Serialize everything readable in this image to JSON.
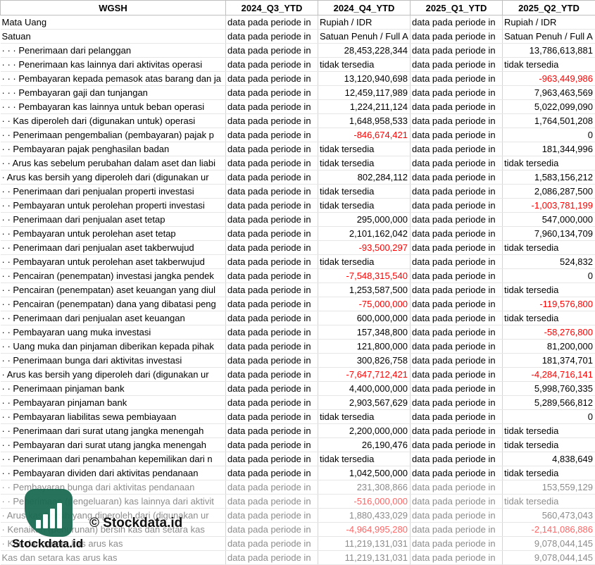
{
  "header": [
    "WGSH",
    "2024_Q3_YTD",
    "2024_Q4_YTD",
    "2025_Q1_YTD",
    "2025_Q2_YTD"
  ],
  "rows": [
    {
      "label": "Mata Uang",
      "cells": [
        "data pada periode in",
        "Rupiah / IDR",
        "data pada periode in",
        "Rupiah / IDR"
      ]
    },
    {
      "label": "Satuan",
      "cells": [
        "data pada periode in",
        "Satuan Penuh / Full A",
        "data pada periode in",
        "Satuan Penuh / Full A"
      ]
    },
    {
      "label": "· · · Penerimaan dari pelanggan",
      "cells": [
        "data pada periode in",
        "28,453,228,344",
        "data pada periode in",
        "13,786,613,881"
      ]
    },
    {
      "label": "· · · Penerimaan kas lainnya dari aktivitas operasi",
      "cells": [
        "data pada periode in",
        "tidak tersedia",
        "data pada periode in",
        "tidak tersedia"
      ]
    },
    {
      "label": "· · · Pembayaran kepada pemasok atas barang dan ja",
      "cells": [
        "data pada periode in",
        "13,120,940,698",
        "data pada periode in",
        "-963,449,986"
      ]
    },
    {
      "label": "· · · Pembayaran gaji dan tunjangan",
      "cells": [
        "data pada periode in",
        "12,459,117,989",
        "data pada periode in",
        "7,963,463,569"
      ]
    },
    {
      "label": "· · · Pembayaran kas lainnya untuk beban operasi",
      "cells": [
        "data pada periode in",
        "1,224,211,124",
        "data pada periode in",
        "5,022,099,090"
      ]
    },
    {
      "label": "· · Kas diperoleh dari (digunakan untuk) operasi",
      "cells": [
        "data pada periode in",
        "1,648,958,533",
        "data pada periode in",
        "1,764,501,208"
      ]
    },
    {
      "label": "· · Penerimaan pengembalian (pembayaran) pajak p",
      "cells": [
        "data pada periode in",
        "-846,674,421",
        "data pada periode in",
        "0"
      ]
    },
    {
      "label": "· · Pembayaran pajak penghasilan badan",
      "cells": [
        "data pada periode in",
        "tidak tersedia",
        "data pada periode in",
        "181,344,996"
      ]
    },
    {
      "label": "· · Arus kas sebelum perubahan dalam aset dan liabi",
      "cells": [
        "data pada periode in",
        "tidak tersedia",
        "data pada periode in",
        "tidak tersedia"
      ]
    },
    {
      "label": "· Arus kas bersih yang diperoleh dari (digunakan ur",
      "cells": [
        "data pada periode in",
        "802,284,112",
        "data pada periode in",
        "1,583,156,212"
      ]
    },
    {
      "label": "· · Penerimaan dari penjualan properti investasi",
      "cells": [
        "data pada periode in",
        "tidak tersedia",
        "data pada periode in",
        "2,086,287,500"
      ]
    },
    {
      "label": "· · Pembayaran untuk perolehan properti investasi",
      "cells": [
        "data pada periode in",
        "tidak tersedia",
        "data pada periode in",
        "-1,003,781,199"
      ]
    },
    {
      "label": "· · Penerimaan dari penjualan aset tetap",
      "cells": [
        "data pada periode in",
        "295,000,000",
        "data pada periode in",
        "547,000,000"
      ]
    },
    {
      "label": "· · Pembayaran untuk perolehan aset tetap",
      "cells": [
        "data pada periode in",
        "2,101,162,042",
        "data pada periode in",
        "7,960,134,709"
      ]
    },
    {
      "label": "· · Penerimaan dari penjualan aset takberwujud",
      "cells": [
        "data pada periode in",
        "-93,500,297",
        "data pada periode in",
        "tidak tersedia"
      ]
    },
    {
      "label": "· · Pembayaran untuk perolehan aset takberwujud",
      "cells": [
        "data pada periode in",
        "tidak tersedia",
        "data pada periode in",
        "524,832"
      ]
    },
    {
      "label": "· · Pencairan (penempatan) investasi jangka pendek",
      "cells": [
        "data pada periode in",
        "-7,548,315,540",
        "data pada periode in",
        "0"
      ]
    },
    {
      "label": "· · Pencairan (penempatan) aset keuangan yang diul",
      "cells": [
        "data pada periode in",
        "1,253,587,500",
        "data pada periode in",
        "tidak tersedia"
      ]
    },
    {
      "label": "· · Pencairan (penempatan) dana yang dibatasi peng",
      "cells": [
        "data pada periode in",
        "-75,000,000",
        "data pada periode in",
        "-119,576,800"
      ]
    },
    {
      "label": "· · Penerimaan dari penjualan aset keuangan",
      "cells": [
        "data pada periode in",
        "600,000,000",
        "data pada periode in",
        "tidak tersedia"
      ]
    },
    {
      "label": "· · Pembayaran uang muka investasi",
      "cells": [
        "data pada periode in",
        "157,348,800",
        "data pada periode in",
        "-58,276,800"
      ]
    },
    {
      "label": "· · Uang muka dan pinjaman diberikan kepada pihak",
      "cells": [
        "data pada periode in",
        "121,800,000",
        "data pada periode in",
        "81,200,000"
      ]
    },
    {
      "label": "· · Penerimaan bunga dari aktivitas investasi",
      "cells": [
        "data pada periode in",
        "300,826,758",
        "data pada periode in",
        "181,374,701"
      ]
    },
    {
      "label": "· Arus kas bersih yang diperoleh dari (digunakan ur",
      "cells": [
        "data pada periode in",
        "-7,647,712,421",
        "data pada periode in",
        "-4,284,716,141"
      ]
    },
    {
      "label": "· · Penerimaan pinjaman bank",
      "cells": [
        "data pada periode in",
        "4,400,000,000",
        "data pada periode in",
        "5,998,760,335"
      ]
    },
    {
      "label": "· · Pembayaran pinjaman bank",
      "cells": [
        "data pada periode in",
        "2,903,567,629",
        "data pada periode in",
        "5,289,566,812"
      ]
    },
    {
      "label": "· · Pembayaran liabilitas sewa pembiayaan",
      "cells": [
        "data pada periode in",
        "tidak tersedia",
        "data pada periode in",
        "0"
      ]
    },
    {
      "label": "· · Penerimaan dari surat utang jangka menengah",
      "cells": [
        "data pada periode in",
        "2,200,000,000",
        "data pada periode in",
        "tidak tersedia"
      ]
    },
    {
      "label": "· · Pembayaran dari surat utang jangka menengah",
      "cells": [
        "data pada periode in",
        "26,190,476",
        "data pada periode in",
        "tidak tersedia"
      ]
    },
    {
      "label": "· · Penerimaan dari penambahan kepemilikan dari n",
      "cells": [
        "data pada periode in",
        "tidak tersedia",
        "data pada periode in",
        "4,838,649"
      ]
    },
    {
      "label": "· · Pembayaran dividen dari aktivitas pendanaan",
      "cells": [
        "data pada periode in",
        "1,042,500,000",
        "data pada periode in",
        "tidak tersedia"
      ]
    },
    {
      "label": "· · Pembayaran bunga dari aktivitas pendanaan",
      "cells": [
        "data pada periode in",
        "231,308,866",
        "data pada periode in",
        "153,559,129"
      ],
      "faded": true
    },
    {
      "label": "· · Penerimaan (pengeluaran) kas lainnya dari aktivit",
      "cells": [
        "data pada periode in",
        "-516,000,000",
        "data pada periode in",
        "tidak tersedia"
      ],
      "faded": true
    },
    {
      "label": "· Arus kas bersih yang diperoleh dari (digunakan ur",
      "cells": [
        "data pada periode in",
        "1,880,433,029",
        "data pada periode in",
        "560,473,043"
      ],
      "faded": true
    },
    {
      "label": "· Kenaikan (penurunan) bersih kas dan setara kas",
      "cells": [
        "data pada periode in",
        "-4,964,995,280",
        "data pada periode in",
        "-2,141,086,886"
      ],
      "faded": true
    },
    {
      "label": "· Kas dan setara kas arus kas",
      "cells": [
        "data pada periode in",
        "11,219,131,031",
        "data pada periode in",
        "9,078,044,145"
      ],
      "faded": true
    },
    {
      "label": "Kas dan setara kas arus kas",
      "cells": [
        "data pada periode in",
        "11,219,131,031",
        "data pada periode in",
        "9,078,044,145"
      ],
      "faded": true
    }
  ],
  "watermark": {
    "text_main": "© Stockdata.id",
    "text_logo": "Stockdata.id",
    "icon": "bar-chart-logo-icon",
    "logo_color": "#1b6b52"
  },
  "colors": {
    "negative": "#ff0000",
    "grid": "#d4d4d4"
  }
}
